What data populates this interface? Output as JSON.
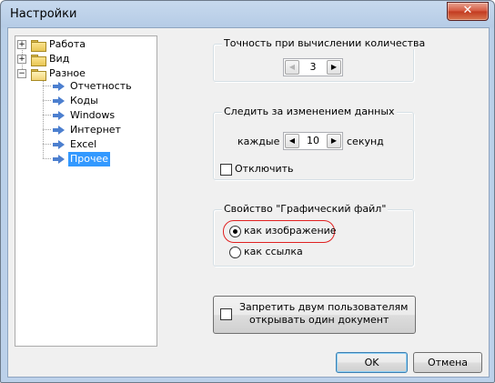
{
  "window": {
    "title": "Настройки",
    "close_glyph": "✕"
  },
  "tree": {
    "items": [
      {
        "label": "Работа",
        "expander": "+",
        "icon": "folder-icon"
      },
      {
        "label": "Вид",
        "expander": "+",
        "icon": "folder-icon"
      },
      {
        "label": "Разное",
        "expander": "−",
        "icon": "folder-open-icon"
      },
      {
        "label": "Отчетность",
        "icon": "arrow-icon"
      },
      {
        "label": "Коды",
        "icon": "arrow-icon"
      },
      {
        "label": "Windows",
        "icon": "arrow-icon"
      },
      {
        "label": "Интернет",
        "icon": "arrow-icon"
      },
      {
        "label": "Excel",
        "icon": "arrow-icon"
      },
      {
        "label": "Прочее",
        "icon": "arrow-icon",
        "selected": true
      }
    ]
  },
  "precision": {
    "legend": "Точность при вычислении количества",
    "value": "3",
    "left_glyph": "◀",
    "right_glyph": "▶"
  },
  "monitor": {
    "legend": "Следить за изменением данных",
    "every_label": "каждые",
    "value": "10",
    "unit_label": "секунд",
    "left_glyph": "◀",
    "right_glyph": "▶",
    "disable_label": "Отключить",
    "disable_checked": false
  },
  "graphic_file": {
    "legend": "Свойство \"Графический файл\"",
    "option_image": "как изображение",
    "option_link": "как ссылка",
    "selected": "как изображение"
  },
  "prevent_sharing": {
    "label_line1": "Запретить двум пользователям",
    "label_line2": "открывать один документ",
    "checked": false
  },
  "buttons": {
    "ok": "OK",
    "cancel": "Отмена"
  },
  "colors": {
    "selection": "#3399ff",
    "highlight_oval": "#e02020",
    "close_button": "#c23a20"
  }
}
